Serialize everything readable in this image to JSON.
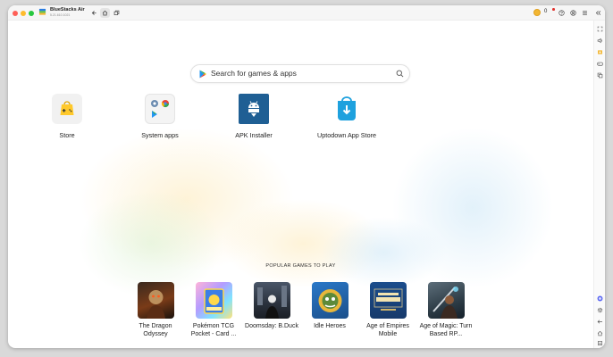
{
  "titlebar": {
    "app_title": "BlueStacks Air",
    "app_version": "5.21.610.1021",
    "coin_count": "0"
  },
  "search": {
    "placeholder": "Search for games & apps"
  },
  "apps": [
    {
      "label": "Store"
    },
    {
      "label": "System apps"
    },
    {
      "label": "APK Installer"
    },
    {
      "label": "Uptodown App Store"
    }
  ],
  "popular": {
    "title": "POPULAR GAMES TO PLAY",
    "games": [
      {
        "name": "The Dragon Odyssey"
      },
      {
        "name": "Pokémon TCG Pocket - Card ..."
      },
      {
        "name": "Doomsday: B.Duck"
      },
      {
        "name": "Idle Heroes"
      },
      {
        "name": "Age of Empires Mobile"
      },
      {
        "name": "Age of Magic: Turn Based RP..."
      }
    ]
  },
  "icons": {
    "titlebar": [
      "back-icon",
      "home-icon",
      "multi-instance-icon",
      "coin-icon",
      "help-icon",
      "account-icon",
      "menu-icon",
      "collapse-icon"
    ],
    "sidebar": [
      "fullscreen-icon",
      "volume-icon",
      "screenshot-icon",
      "gamepad-icon",
      "copy-icon",
      "discord-icon",
      "settings-icon",
      "back-icon",
      "home-icon",
      "recents-icon"
    ]
  },
  "colors": {
    "accent_blue": "#1c6ee8",
    "traffic_close": "#fe5f57",
    "traffic_min": "#febc2e",
    "traffic_max": "#28c840",
    "store_yellow": "#ffc92b",
    "apk_blue": "#1f5f94",
    "uptodown_blue": "#1ea1de"
  }
}
